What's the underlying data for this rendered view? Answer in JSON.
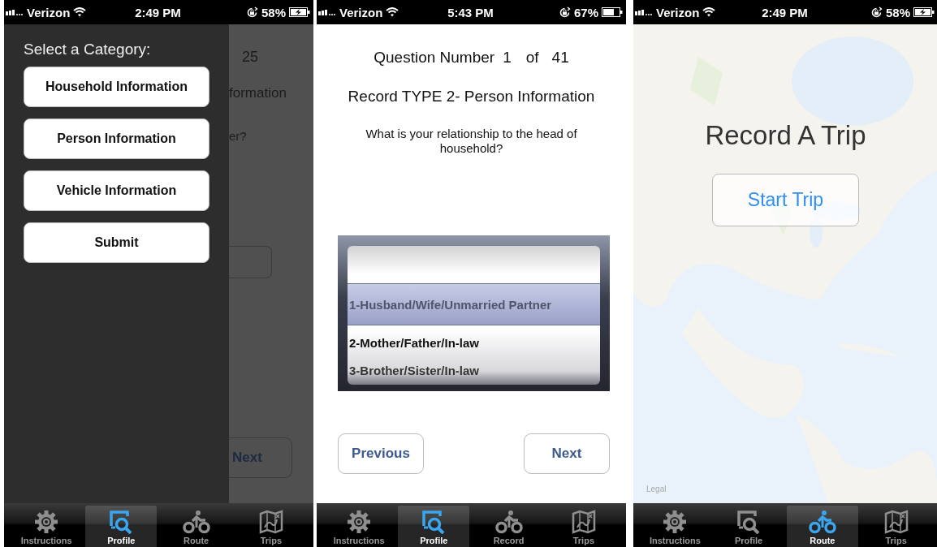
{
  "phones": [
    {
      "kind": "category-menu",
      "status_bar": {
        "carrier": "Verizon",
        "time": "2:49 PM",
        "battery": "58%",
        "charging": true
      },
      "behind": {
        "count": "25",
        "subtitle": "formation",
        "question": "er?",
        "next_button": "Next"
      },
      "menu": {
        "title": "Select a Category:",
        "buttons": [
          "Household Information",
          "Person Information",
          "Vehicle Information",
          "Submit"
        ]
      },
      "tab_bar": [
        {
          "label": "Instructions",
          "kind": "gear",
          "selected": false
        },
        {
          "label": "Profile",
          "kind": "search",
          "selected": true
        },
        {
          "label": "Route",
          "kind": "bike",
          "selected": false
        },
        {
          "label": "Trips",
          "kind": "map",
          "selected": false
        }
      ]
    },
    {
      "kind": "question",
      "status_bar": {
        "carrier": "Verizon",
        "time": "5:43 PM",
        "battery": "67%",
        "charging": false
      },
      "question_number": {
        "label": "Question Number",
        "current": "1",
        "of": "of",
        "total": "41"
      },
      "record_type": "Record TYPE 2- Person Information",
      "question": "What is your relationship to the head of household?",
      "picker": {
        "options": [
          {
            "label": "1-Husband/Wife/Unmarried Partner",
            "selected": true
          },
          {
            "label": "2-Mother/Father/In-law",
            "selected": false
          },
          {
            "label": "3-Brother/Sister/In-law",
            "selected": false
          }
        ]
      },
      "buttons": [
        "Previous",
        "Next"
      ],
      "tab_bar": [
        {
          "label": "Instructions",
          "kind": "gear",
          "selected": false
        },
        {
          "label": "Profile",
          "kind": "search",
          "selected": true
        },
        {
          "label": "Record",
          "kind": "bike",
          "selected": false
        },
        {
          "label": "Trips",
          "kind": "map",
          "selected": false
        }
      ]
    },
    {
      "kind": "map",
      "status_bar": {
        "carrier": "Verizon",
        "time": "2:49 PM",
        "battery": "58%",
        "charging": true
      },
      "title": "Record A Trip",
      "start_button": "Start Trip",
      "legal_link": "Legal",
      "tab_bar": [
        {
          "label": "Instructions",
          "kind": "gear",
          "selected": false
        },
        {
          "label": "Profile",
          "kind": "search",
          "selected": false
        },
        {
          "label": "Route",
          "kind": "bike",
          "selected": true
        },
        {
          "label": "Trips",
          "kind": "map",
          "selected": false
        }
      ]
    }
  ]
}
